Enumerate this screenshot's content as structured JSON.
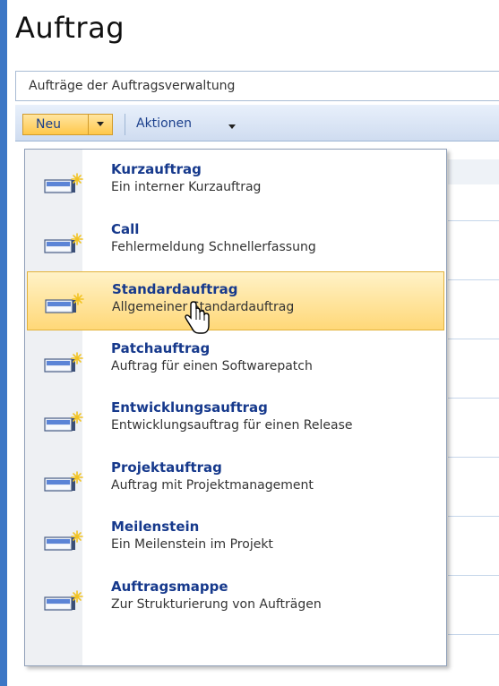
{
  "page": {
    "title": "Auftrag",
    "description": "Aufträge der Auftragsverwaltung"
  },
  "toolbar": {
    "new_label": "Neu",
    "actions_label": "Aktionen"
  },
  "menu": {
    "hovered_index": 2,
    "items": [
      {
        "title": "Kurzauftrag",
        "desc": "Ein interner Kurzauftrag"
      },
      {
        "title": "Call",
        "desc": "Fehlermeldung Schnellerfassung"
      },
      {
        "title": "Standardauftrag",
        "desc": "Allgemeiner Standardauftrag"
      },
      {
        "title": "Patchauftrag",
        "desc": "Auftrag für einen Softwarepatch"
      },
      {
        "title": "Entwicklungsauftrag",
        "desc": "Entwicklungsauftrag für einen Release"
      },
      {
        "title": "Projektauftrag",
        "desc": "Auftrag mit Projektmanagement"
      },
      {
        "title": "Meilenstein",
        "desc": "Ein Meilenstein im Projekt"
      },
      {
        "title": "Auftragsmappe",
        "desc": "Zur Strukturierung von Aufträgen"
      }
    ]
  },
  "icons": {
    "new_item": "new-item-icon",
    "cursor": "hand-cursor-icon"
  },
  "colors": {
    "accent": "#3d77c5",
    "link": "#16398c",
    "hover_bg": "#ffd878",
    "button_bg": "#ffc84a"
  }
}
